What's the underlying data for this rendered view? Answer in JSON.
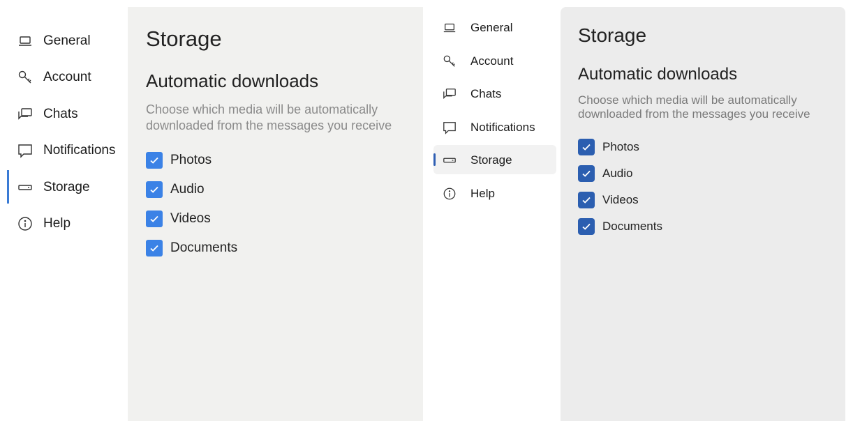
{
  "left_panel": {
    "nav": {
      "items": [
        {
          "label": "General",
          "icon": "laptop-icon"
        },
        {
          "label": "Account",
          "icon": "key-icon"
        },
        {
          "label": "Chats",
          "icon": "chats-icon"
        },
        {
          "label": "Notifications",
          "icon": "notification-icon"
        },
        {
          "label": "Storage",
          "icon": "storage-icon"
        },
        {
          "label": "Help",
          "icon": "info-icon"
        }
      ],
      "selected": "Storage"
    },
    "page_title": "Storage",
    "section_title": "Automatic downloads",
    "description": "Choose which media will be automatically downloaded from the messages you receive",
    "options": [
      {
        "label": "Photos",
        "checked": true
      },
      {
        "label": "Audio",
        "checked": true
      },
      {
        "label": "Videos",
        "checked": true
      },
      {
        "label": "Documents",
        "checked": true
      }
    ],
    "colors": {
      "accent": "#3b82e6",
      "content_bg": "#f1f1ef"
    }
  },
  "right_panel": {
    "nav": {
      "items": [
        {
          "label": "General",
          "icon": "laptop-icon"
        },
        {
          "label": "Account",
          "icon": "key-icon"
        },
        {
          "label": "Chats",
          "icon": "chats-icon"
        },
        {
          "label": "Notifications",
          "icon": "notification-icon"
        },
        {
          "label": "Storage",
          "icon": "storage-icon"
        },
        {
          "label": "Help",
          "icon": "info-icon"
        }
      ],
      "selected": "Storage"
    },
    "page_title": "Storage",
    "section_title": "Automatic downloads",
    "description": "Choose which media will be automatically downloaded from the messages you receive",
    "options": [
      {
        "label": "Photos",
        "checked": true
      },
      {
        "label": "Audio",
        "checked": true
      },
      {
        "label": "Videos",
        "checked": true
      },
      {
        "label": "Documents",
        "checked": true
      }
    ],
    "colors": {
      "accent": "#2b5eb0",
      "content_bg": "#ececec"
    }
  }
}
